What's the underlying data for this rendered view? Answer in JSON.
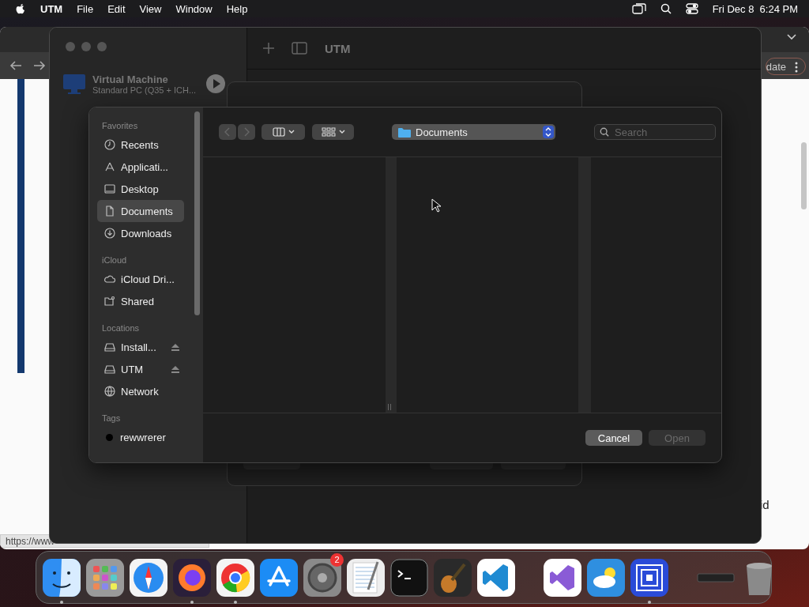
{
  "menu_bar": {
    "app": "UTM",
    "items": [
      "File",
      "Edit",
      "View",
      "Window",
      "Help"
    ],
    "clock": "Fri Dec 8  6:24 PM"
  },
  "browser": {
    "button": "date",
    "text_fragment": "id",
    "status_url": "https://www"
  },
  "utm_window": {
    "title": "UTM",
    "vm": {
      "name": "Virtual Machine",
      "detail": "Standard PC (Q35 + ICH..."
    }
  },
  "open_dialog": {
    "sidebar": [
      {
        "heading": "Favorites",
        "items": [
          {
            "label": "Recents",
            "kind": "clock",
            "selected": false
          },
          {
            "label": "Applicati...",
            "kind": "apps",
            "selected": false
          },
          {
            "label": "Desktop",
            "kind": "desktop",
            "selected": false
          },
          {
            "label": "Documents",
            "kind": "document",
            "selected": true
          },
          {
            "label": "Downloads",
            "kind": "download",
            "selected": false
          }
        ]
      },
      {
        "heading": "iCloud",
        "items": [
          {
            "label": "iCloud Dri...",
            "kind": "cloud",
            "selected": false
          },
          {
            "label": "Shared",
            "kind": "shared",
            "selected": false
          }
        ]
      },
      {
        "heading": "Locations",
        "items": [
          {
            "label": "Install...",
            "kind": "drive",
            "eject": true,
            "selected": false
          },
          {
            "label": "UTM",
            "kind": "drive",
            "eject": true,
            "selected": false
          },
          {
            "label": "Network",
            "kind": "network",
            "selected": false
          }
        ]
      },
      {
        "heading": "Tags",
        "items": [
          {
            "label": "rewwrerer",
            "kind": "tag",
            "color": "#000000",
            "selected": false
          }
        ]
      }
    ],
    "location": "Documents",
    "search": {
      "placeholder": "Search"
    },
    "buttons": [
      {
        "label": "Cancel",
        "disabled": false
      },
      {
        "label": "Open",
        "disabled": true
      }
    ]
  },
  "dock": {
    "apps": [
      {
        "kind": "finder",
        "running": true
      },
      {
        "kind": "launchpad",
        "running": false
      },
      {
        "kind": "safari",
        "running": false
      },
      {
        "kind": "firefox",
        "running": true
      },
      {
        "kind": "chrome",
        "running": true
      },
      {
        "kind": "appstore",
        "running": false
      },
      {
        "kind": "settings",
        "running": false,
        "badge": "2"
      },
      {
        "kind": "textedit",
        "running": false
      },
      {
        "kind": "terminal",
        "running": false
      },
      {
        "kind": "guitar",
        "running": false
      },
      {
        "kind": "vscode",
        "running": false
      },
      {
        "kind": "separator"
      },
      {
        "kind": "visualstudio",
        "running": false
      },
      {
        "kind": "weather",
        "running": false
      },
      {
        "kind": "utm",
        "running": true
      },
      {
        "kind": "separator"
      },
      {
        "kind": "window",
        "running": false
      },
      {
        "kind": "trash",
        "running": false
      }
    ]
  }
}
